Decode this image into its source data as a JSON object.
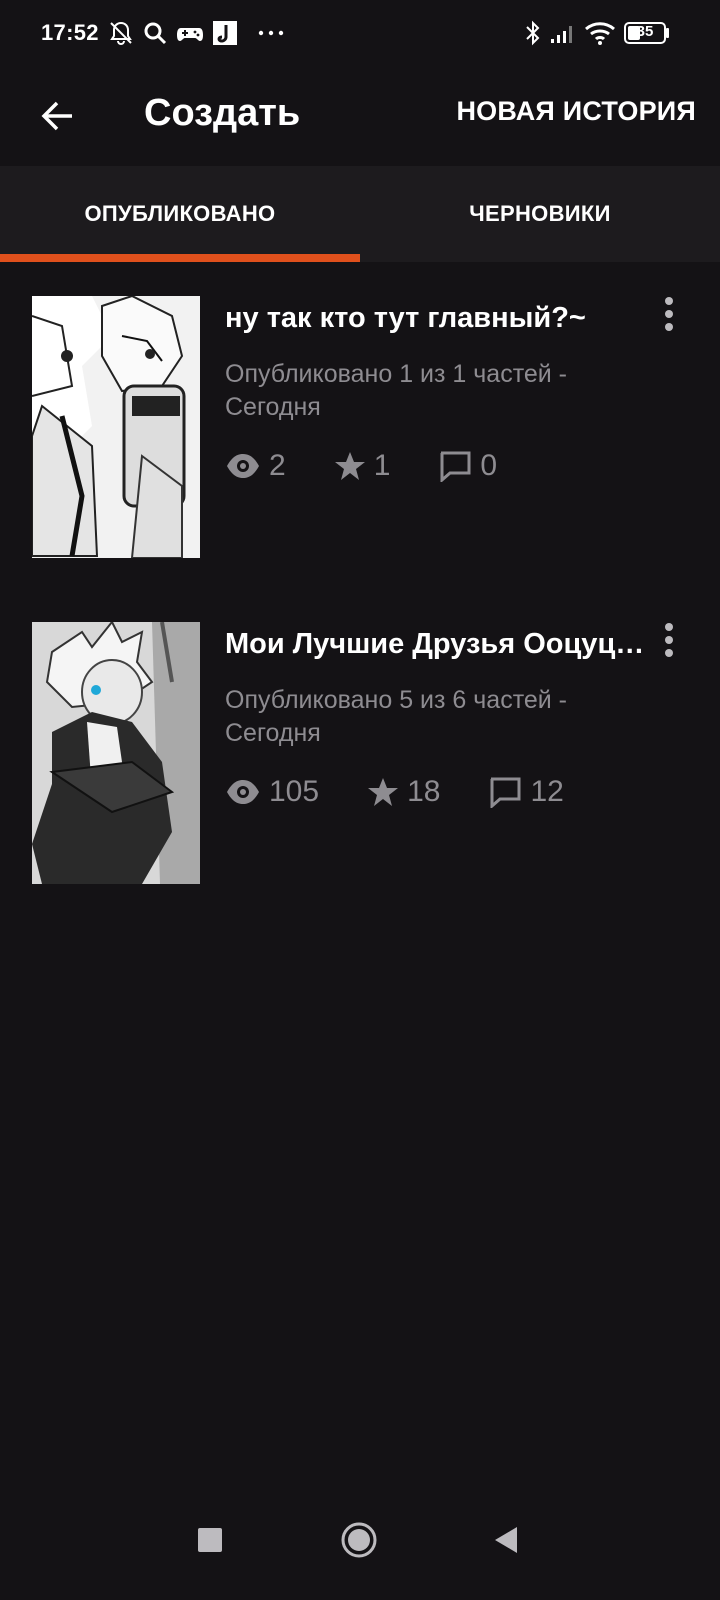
{
  "status_bar": {
    "time": "17:52",
    "battery": "35",
    "icons": [
      "bell-off-icon",
      "search-icon",
      "gamepad-icon",
      "music-app-icon",
      "more-dots-icon",
      "bluetooth-icon",
      "signal-icon",
      "wifi-icon",
      "battery-icon"
    ]
  },
  "appbar": {
    "title": "Создать",
    "action": "НОВАЯ ИСТОРИЯ"
  },
  "tabs": [
    {
      "label": "ОПУБЛИКОВАНО",
      "selected": true
    },
    {
      "label": "ЧЕРНОВИКИ",
      "selected": false
    }
  ],
  "accent_color": "#e0501c",
  "stories": [
    {
      "title": "ну так кто тут главный?~",
      "meta": "Опубликовано 1 из 1 частей - Сегодня",
      "views": "2",
      "votes": "1",
      "comments": "0"
    },
    {
      "title": "Мои Лучшие Друзья Ооцуцуки",
      "meta": "Опубликовано 5 из 6 частей - Сегодня",
      "views": "105",
      "votes": "18",
      "comments": "12"
    }
  ],
  "nav": {
    "icons": [
      "square-recents-icon",
      "circle-home-icon",
      "triangle-back-icon"
    ]
  }
}
